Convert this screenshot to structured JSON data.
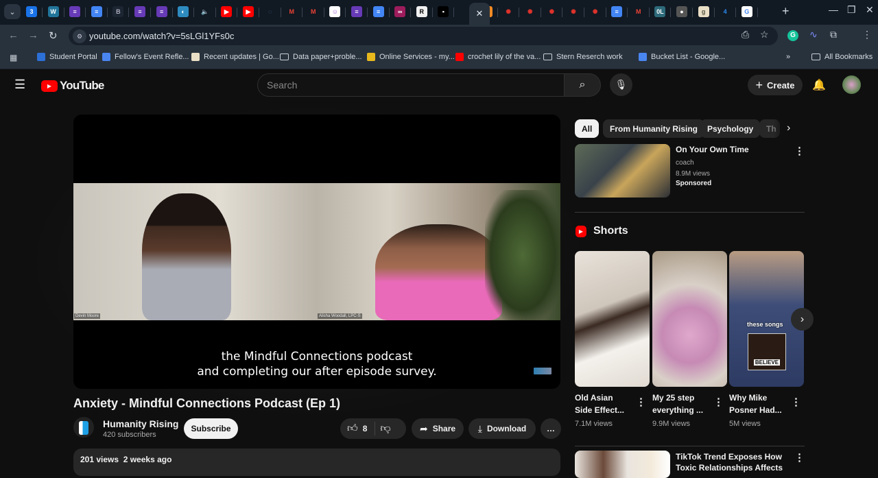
{
  "browser": {
    "tabs": [
      "calendar",
      "wordpress",
      "forms",
      "docs",
      "bold-b",
      "forms",
      "forms",
      "course",
      "audio",
      "youtube",
      "youtube",
      "loading",
      "gmail",
      "gmail",
      "discord-like",
      "forms",
      "docs",
      "link",
      "r-app",
      "nyt",
      "active-close",
      "orange-app",
      "red-dots",
      "red-dots",
      "red-dots",
      "red-dots",
      "red-dots",
      "docs",
      "gmail",
      "ol",
      "globe",
      "goodreads",
      "four",
      "google"
    ],
    "new_tab_label": "+",
    "url": "youtube.com/watch?v=5sLGl1YFs0c",
    "bookmarks": [
      {
        "label": "Student Portal",
        "icon": "portal-icon",
        "color": "#2c6fd6"
      },
      {
        "label": "Fellow's Event Refle...",
        "icon": "docs-icon",
        "color": "#4a86f0"
      },
      {
        "label": "Recent updates | Go...",
        "icon": "goodreads-icon",
        "color": "#e9dfc6"
      },
      {
        "label": "Data paper+proble...",
        "icon": "folder-icon",
        "color": ""
      },
      {
        "label": "Online Services - my...",
        "icon": "umd-icon",
        "color": "#e8b81c"
      },
      {
        "label": "crochet lily of the va...",
        "icon": "youtube-icon",
        "color": "#ff0000"
      },
      {
        "label": "Stern Reserch work",
        "icon": "folder-icon",
        "color": ""
      },
      {
        "label": "Bucket List - Google...",
        "icon": "docs-icon",
        "color": "#4a86f0"
      }
    ],
    "more_bookmarks": "»",
    "all_bookmarks": "All Bookmarks"
  },
  "youtube": {
    "logo_text": "YouTube",
    "search_placeholder": "Search",
    "create_label": "Create",
    "video": {
      "caption_line1": "the Mindful Connections podcast",
      "caption_line2": "and completing our after episode survey.",
      "name_left": "Devin Moore",
      "name_right": "Alisha Woodall, LPC-S",
      "title": "Anxiety - Mindful Connections Podcast (Ep 1)",
      "channel": "Humanity Rising",
      "subscribers": "420 subscribers",
      "subscribe_label": "Subscribe",
      "likes": "8",
      "share_label": "Share",
      "download_label": "Download",
      "views": "201 views",
      "age": "2 weeks ago"
    },
    "chips": [
      "All",
      "From Humanity Rising",
      "Psychology",
      "Th"
    ],
    "ad": {
      "title": "On Your Own Time",
      "channel": "coach",
      "views": "8.9M views",
      "badge": "Sponsored"
    },
    "shorts_heading": "Shorts",
    "shorts": [
      {
        "title_line1": "Old Asian",
        "title_line2": "Side Effect...",
        "views": "7.1M views"
      },
      {
        "title_line1": "My 25 step",
        "title_line2": "everything ...",
        "views": "9.9M views"
      },
      {
        "title_line1": "Why Mike",
        "title_line2": "Posner Had...",
        "views": "5M views",
        "overlay": "these songs",
        "overlay2": "BELIEVE"
      }
    ],
    "next_video": {
      "title": "TikTok Trend Exposes How Toxic Relationships Affects"
    }
  }
}
